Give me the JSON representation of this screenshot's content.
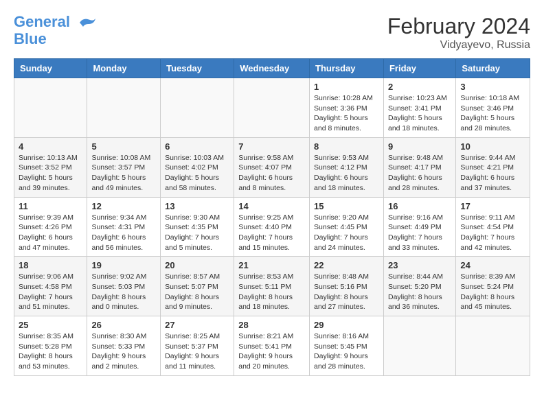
{
  "logo": {
    "line1": "General",
    "line2": "Blue"
  },
  "title": "February 2024",
  "location": "Vidyayevo, Russia",
  "weekdays": [
    "Sunday",
    "Monday",
    "Tuesday",
    "Wednesday",
    "Thursday",
    "Friday",
    "Saturday"
  ],
  "weeks": [
    [
      {
        "day": "",
        "info": ""
      },
      {
        "day": "",
        "info": ""
      },
      {
        "day": "",
        "info": ""
      },
      {
        "day": "",
        "info": ""
      },
      {
        "day": "1",
        "info": "Sunrise: 10:28 AM\nSunset: 3:36 PM\nDaylight: 5 hours\nand 8 minutes."
      },
      {
        "day": "2",
        "info": "Sunrise: 10:23 AM\nSunset: 3:41 PM\nDaylight: 5 hours\nand 18 minutes."
      },
      {
        "day": "3",
        "info": "Sunrise: 10:18 AM\nSunset: 3:46 PM\nDaylight: 5 hours\nand 28 minutes."
      }
    ],
    [
      {
        "day": "4",
        "info": "Sunrise: 10:13 AM\nSunset: 3:52 PM\nDaylight: 5 hours\nand 39 minutes."
      },
      {
        "day": "5",
        "info": "Sunrise: 10:08 AM\nSunset: 3:57 PM\nDaylight: 5 hours\nand 49 minutes."
      },
      {
        "day": "6",
        "info": "Sunrise: 10:03 AM\nSunset: 4:02 PM\nDaylight: 5 hours\nand 58 minutes."
      },
      {
        "day": "7",
        "info": "Sunrise: 9:58 AM\nSunset: 4:07 PM\nDaylight: 6 hours\nand 8 minutes."
      },
      {
        "day": "8",
        "info": "Sunrise: 9:53 AM\nSunset: 4:12 PM\nDaylight: 6 hours\nand 18 minutes."
      },
      {
        "day": "9",
        "info": "Sunrise: 9:48 AM\nSunset: 4:17 PM\nDaylight: 6 hours\nand 28 minutes."
      },
      {
        "day": "10",
        "info": "Sunrise: 9:44 AM\nSunset: 4:21 PM\nDaylight: 6 hours\nand 37 minutes."
      }
    ],
    [
      {
        "day": "11",
        "info": "Sunrise: 9:39 AM\nSunset: 4:26 PM\nDaylight: 6 hours\nand 47 minutes."
      },
      {
        "day": "12",
        "info": "Sunrise: 9:34 AM\nSunset: 4:31 PM\nDaylight: 6 hours\nand 56 minutes."
      },
      {
        "day": "13",
        "info": "Sunrise: 9:30 AM\nSunset: 4:35 PM\nDaylight: 7 hours\nand 5 minutes."
      },
      {
        "day": "14",
        "info": "Sunrise: 9:25 AM\nSunset: 4:40 PM\nDaylight: 7 hours\nand 15 minutes."
      },
      {
        "day": "15",
        "info": "Sunrise: 9:20 AM\nSunset: 4:45 PM\nDaylight: 7 hours\nand 24 minutes."
      },
      {
        "day": "16",
        "info": "Sunrise: 9:16 AM\nSunset: 4:49 PM\nDaylight: 7 hours\nand 33 minutes."
      },
      {
        "day": "17",
        "info": "Sunrise: 9:11 AM\nSunset: 4:54 PM\nDaylight: 7 hours\nand 42 minutes."
      }
    ],
    [
      {
        "day": "18",
        "info": "Sunrise: 9:06 AM\nSunset: 4:58 PM\nDaylight: 7 hours\nand 51 minutes."
      },
      {
        "day": "19",
        "info": "Sunrise: 9:02 AM\nSunset: 5:03 PM\nDaylight: 8 hours\nand 0 minutes."
      },
      {
        "day": "20",
        "info": "Sunrise: 8:57 AM\nSunset: 5:07 PM\nDaylight: 8 hours\nand 9 minutes."
      },
      {
        "day": "21",
        "info": "Sunrise: 8:53 AM\nSunset: 5:11 PM\nDaylight: 8 hours\nand 18 minutes."
      },
      {
        "day": "22",
        "info": "Sunrise: 8:48 AM\nSunset: 5:16 PM\nDaylight: 8 hours\nand 27 minutes."
      },
      {
        "day": "23",
        "info": "Sunrise: 8:44 AM\nSunset: 5:20 PM\nDaylight: 8 hours\nand 36 minutes."
      },
      {
        "day": "24",
        "info": "Sunrise: 8:39 AM\nSunset: 5:24 PM\nDaylight: 8 hours\nand 45 minutes."
      }
    ],
    [
      {
        "day": "25",
        "info": "Sunrise: 8:35 AM\nSunset: 5:28 PM\nDaylight: 8 hours\nand 53 minutes."
      },
      {
        "day": "26",
        "info": "Sunrise: 8:30 AM\nSunset: 5:33 PM\nDaylight: 9 hours\nand 2 minutes."
      },
      {
        "day": "27",
        "info": "Sunrise: 8:25 AM\nSunset: 5:37 PM\nDaylight: 9 hours\nand 11 minutes."
      },
      {
        "day": "28",
        "info": "Sunrise: 8:21 AM\nSunset: 5:41 PM\nDaylight: 9 hours\nand 20 minutes."
      },
      {
        "day": "29",
        "info": "Sunrise: 8:16 AM\nSunset: 5:45 PM\nDaylight: 9 hours\nand 28 minutes."
      },
      {
        "day": "",
        "info": ""
      },
      {
        "day": "",
        "info": ""
      }
    ]
  ]
}
